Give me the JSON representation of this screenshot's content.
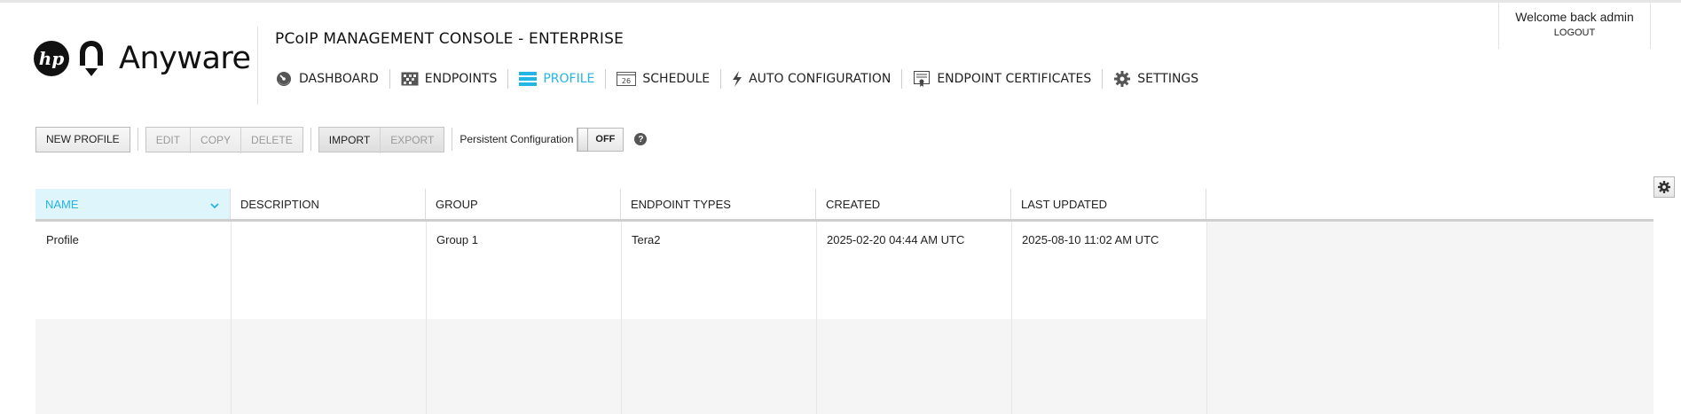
{
  "brand": {
    "logo_text": "Anyware",
    "hp_mark": "hp"
  },
  "header": {
    "app_title": "PCoIP MANAGEMENT CONSOLE - ENTERPRISE"
  },
  "nav": {
    "items": [
      {
        "label": "DASHBOARD",
        "icon": "dashboard-gauge-icon",
        "active": false
      },
      {
        "label": "ENDPOINTS",
        "icon": "endpoints-grid-icon",
        "active": false
      },
      {
        "label": "PROFILE",
        "icon": "profile-stack-icon",
        "active": true
      },
      {
        "label": "SCHEDULE",
        "icon": "calendar-icon",
        "calendar_day": "26",
        "active": false
      },
      {
        "label": "AUTO CONFIGURATION",
        "icon": "lightning-icon",
        "active": false
      },
      {
        "label": "ENDPOINT CERTIFICATES",
        "icon": "certificate-icon",
        "active": false
      },
      {
        "label": "SETTINGS",
        "icon": "gear-icon",
        "active": false
      }
    ]
  },
  "user": {
    "welcome": "Welcome back admin",
    "logout": "LOGOUT"
  },
  "toolbar": {
    "new_profile": "NEW PROFILE",
    "edit": "EDIT",
    "copy": "COPY",
    "delete": "DELETE",
    "import": "IMPORT",
    "export": "EXPORT",
    "persistent_label": "Persistent Configuration",
    "toggle_state": "OFF",
    "help": "?"
  },
  "colors": {
    "accent": "#24b5e5",
    "active_header_bg": "#dff5fc"
  },
  "grid": {
    "columns": [
      "NAME",
      "DESCRIPTION",
      "GROUP",
      "ENDPOINT TYPES",
      "CREATED",
      "LAST UPDATED"
    ],
    "sorted_column": "NAME",
    "sort_direction": "descending",
    "rows": [
      [
        "Profile",
        "",
        "Group 1",
        "Tera2",
        "2025-02-20 04:44 AM UTC",
        "2025-08-10 11:02 AM UTC"
      ]
    ]
  }
}
